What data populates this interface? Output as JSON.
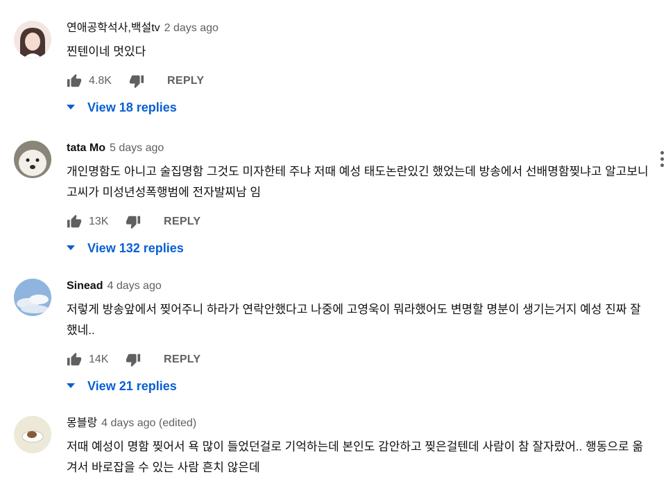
{
  "comments": [
    {
      "author": "연애공학석사,백설tv",
      "time": "2 days ago",
      "text": "찐텐이네 멋있다",
      "likes": "4.8K",
      "reply_label": "REPLY",
      "replies_label": "View 18 replies",
      "avatar_color": "#e9c9c6"
    },
    {
      "author": "tata Mo",
      "time": "5 days ago",
      "text": "개인명함도 아니고 술집명함 그것도 미자한테 주냐 저때 예성 태도논란있긴 했었는데 방송에서 선배명함찢냐고 알고보니 고씨가 미성년성폭행범에 전자발찌남 임",
      "likes": "13K",
      "reply_label": "REPLY",
      "replies_label": "View 132 replies",
      "avatar_color": "#d9d5cf"
    },
    {
      "author": "Sinead",
      "time": "4 days ago",
      "text": "저렇게 방송앞에서 찢어주니 하라가 연락안했다고 나중에 고영욱이 뭐라했어도 변명할 명분이 생기는거지 예성 진짜 잘했네..",
      "likes": "14K",
      "reply_label": "REPLY",
      "replies_label": "View 21 replies",
      "avatar_color": "#9fbfe0"
    },
    {
      "author": "몽블랑",
      "time": "4 days ago (edited)",
      "text": "저때 예성이 명함 찢어서 욕 많이 들었던걸로 기억하는데 본인도 감안하고 찢은걸텐데 사람이 참 잘자랐어.. 행동으로 옮겨서 바로잡을 수 있는 사람 흔치 않은데"
    }
  ],
  "icons": {
    "like": "thumbs-up-icon",
    "dislike": "thumbs-down-icon",
    "expand": "chevron-down-icon",
    "more": "more-vertical-icon"
  },
  "colors": {
    "link": "#065fd4",
    "secondary": "#606060",
    "text": "#0f0f0f"
  }
}
